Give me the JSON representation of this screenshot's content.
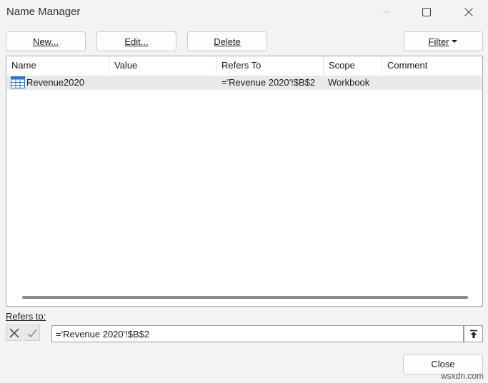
{
  "window": {
    "title": "Name Manager"
  },
  "toolbar": {
    "new_label": "New...",
    "edit_label": "Edit...",
    "delete_label": "Delete",
    "filter_label": "Filter"
  },
  "table": {
    "columns": [
      "Name",
      "Value",
      "Refers To",
      "Scope",
      "Comment"
    ],
    "rows": [
      {
        "icon": "table-name-icon",
        "name": "Revenue2020",
        "value": "",
        "refers_to": "='Revenue 2020'!$B$2",
        "scope": "Workbook",
        "comment": ""
      }
    ]
  },
  "refers": {
    "label": "Refers to:",
    "value": "='Revenue 2020'!$B$2"
  },
  "footer": {
    "close_label": "Close",
    "watermark": "wsxdn.com"
  },
  "icons": {
    "minimize": "minimize-icon",
    "maximize": "maximize-icon",
    "close": "close-icon",
    "cancel": "cancel-x-icon",
    "confirm": "confirm-check-icon",
    "collapse": "collapse-dialog-icon",
    "filter_caret": "caret-down-icon"
  },
  "colors": {
    "background": "#f3f3f3",
    "selected_row": "#e9e9e9",
    "table_icon": "#2e75c7"
  }
}
